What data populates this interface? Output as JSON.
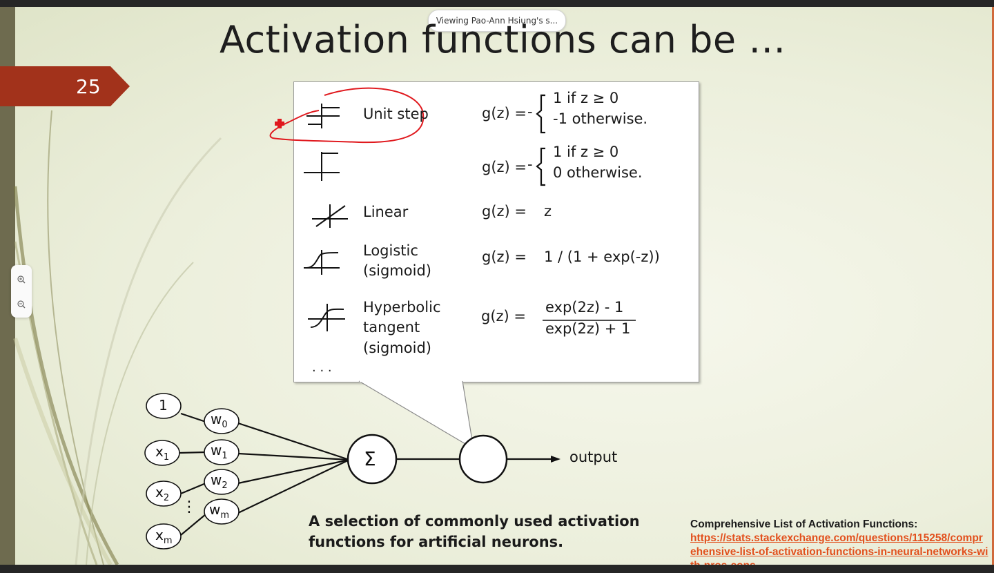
{
  "viewer": {
    "viewing_label": "Viewing Pao-Ann Hsiung's s..."
  },
  "slide": {
    "title": "Activation functions can be …",
    "number": "25"
  },
  "zoom": {
    "zoom_in_icon": "zoom-in-icon",
    "zoom_out_icon": "zoom-out-icon"
  },
  "figure": {
    "functions": [
      {
        "name": "Unit step",
        "formula_lhs": "g(z) =",
        "case1": "1 if z ≥ 0",
        "case2": "-1 otherwise."
      },
      {
        "name": "",
        "formula_lhs": "g(z) =",
        "case1": "1 if z ≥ 0",
        "case2": "0 otherwise."
      },
      {
        "name": "Linear",
        "formula_lhs": "g(z) =",
        "rhs": "z"
      },
      {
        "name_line1": "Logistic",
        "name_line2": "(sigmoid)",
        "formula_lhs": "g(z) =",
        "rhs": "1 / (1 + exp(-z))"
      },
      {
        "name_line1": "Hyperbolic",
        "name_line2": "tangent",
        "name_line3": "(sigmoid)",
        "formula_lhs": "g(z) =",
        "numerator": "exp(2z) - 1",
        "denominator": "exp(2z) + 1"
      }
    ],
    "ellipsis": ". . .",
    "neuron": {
      "inputs": [
        "1",
        "x",
        "x",
        "x"
      ],
      "input_subs": [
        "",
        "1",
        "2",
        "m"
      ],
      "weights": [
        "w",
        "w",
        "w",
        "w"
      ],
      "weight_subs": [
        "0",
        "1",
        "2",
        "m"
      ],
      "vdots": "⋮",
      "sum_symbol": "Σ",
      "output_label": "output"
    },
    "caption_line1": "A selection of commonly used activation",
    "caption_line2": "functions for artificial neurons."
  },
  "reference": {
    "title": "Comprehensive List of Activation Functions:",
    "link": "https://stats.stackexchange.com/questions/115258/comprehensive-list-of-activation-functions-in-neural-networks-with-pros-cons"
  },
  "colors": {
    "slide_number_bg": "#a2321b",
    "link": "#e2501d",
    "annotation": "#e0191e"
  }
}
